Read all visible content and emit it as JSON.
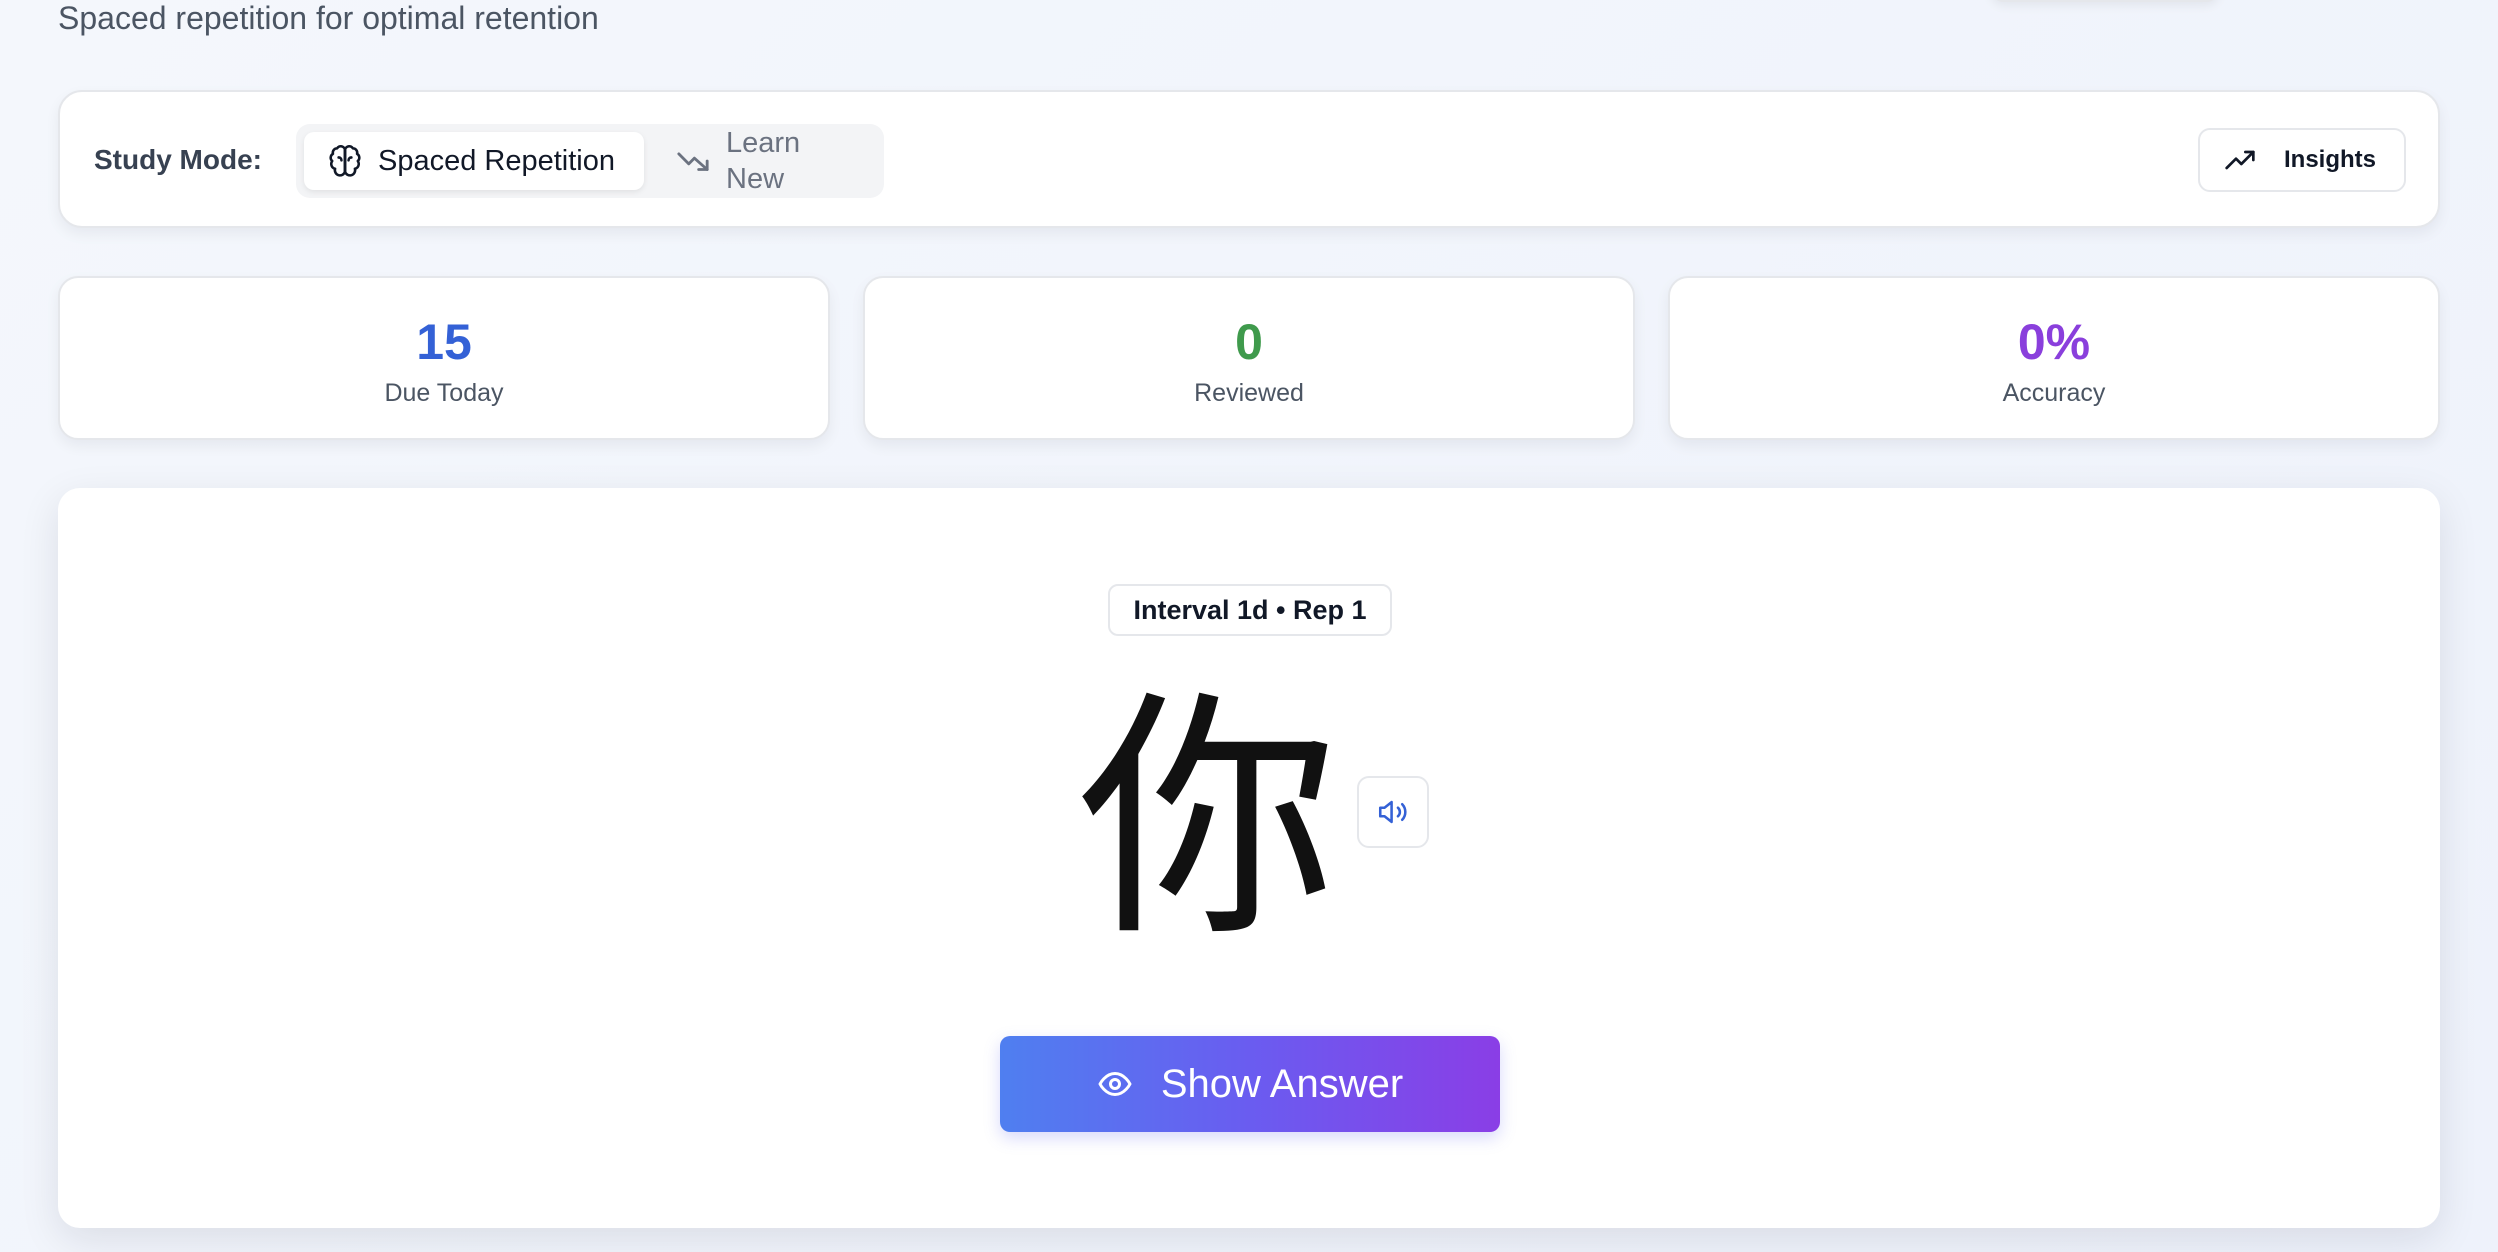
{
  "header": {
    "subtitle": "Spaced repetition for optimal retention"
  },
  "mode_bar": {
    "label": "Study Mode:",
    "modes": [
      {
        "label": "Spaced Repetition",
        "icon": "brain-icon",
        "active": true
      },
      {
        "label": "Learn New",
        "icon": "trending-down-icon",
        "active": false
      }
    ],
    "insights_label": "Insights",
    "insights_icon": "trending-up-icon"
  },
  "stats": [
    {
      "value": "15",
      "label": "Due Today",
      "color": "#3461d6"
    },
    {
      "value": "0",
      "label": "Reviewed",
      "color": "#3f9a4c"
    },
    {
      "value": "0%",
      "label": "Accuracy",
      "color": "#8a3fdc"
    }
  ],
  "card": {
    "badge": "Interval 1d • Rep 1",
    "character": "你",
    "audio_icon": "speaker-icon",
    "show_answer_label": "Show Answer",
    "show_answer_icon": "eye-icon"
  },
  "colors": {
    "accent_start": "#4f7ff0",
    "accent_end": "#8a3ee6",
    "audio_icon": "#3461d6"
  }
}
